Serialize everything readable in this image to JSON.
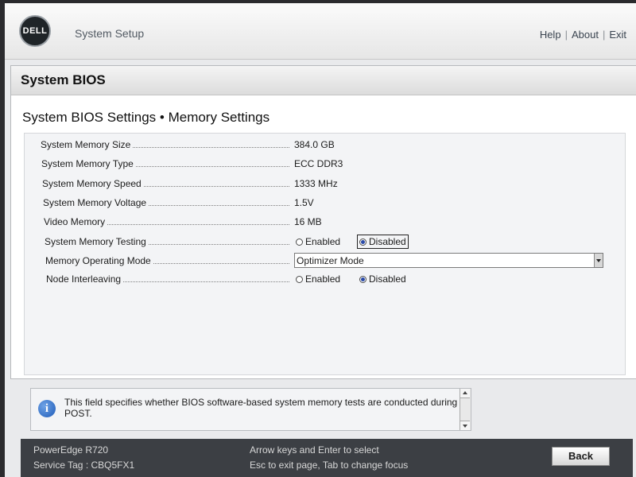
{
  "header": {
    "logo_text": "DELL",
    "app_title": "System Setup",
    "links": {
      "help": "Help",
      "about": "About",
      "exit": "Exit",
      "separator": "|"
    }
  },
  "panel": {
    "title": "System BIOS",
    "section_title": "System BIOS Settings • Memory Settings"
  },
  "settings": {
    "system_memory_size": {
      "label": "System Memory Size",
      "value": "384.0 GB"
    },
    "system_memory_type": {
      "label": "System Memory Type",
      "value": "ECC DDR3"
    },
    "system_memory_speed": {
      "label": "System Memory Speed",
      "value": "1333 MHz"
    },
    "system_memory_voltage": {
      "label": "System Memory Voltage",
      "value": "1.5V"
    },
    "video_memory": {
      "label": "Video Memory",
      "value": "16 MB"
    },
    "system_memory_testing": {
      "label": "System Memory Testing",
      "option_enabled": "Enabled",
      "option_disabled": "Disabled",
      "selected": "Disabled"
    },
    "memory_operating_mode": {
      "label": "Memory Operating Mode",
      "value": "Optimizer Mode"
    },
    "node_interleaving": {
      "label": "Node Interleaving",
      "option_enabled": "Enabled",
      "option_disabled": "Disabled",
      "selected": "Disabled"
    }
  },
  "help": {
    "icon": "info-icon",
    "text": "This field specifies whether BIOS software-based system memory tests are conducted during POST."
  },
  "footer": {
    "model": "PowerEdge R720",
    "service_tag": "Service Tag : CBQ5FX1",
    "hint_line1": "Arrow keys and Enter to select",
    "hint_line2": "Esc to exit page, Tab to change focus",
    "back_label": "Back"
  },
  "colors": {
    "radio_selected": "#2a4aa8",
    "footer_bg": "#3c3f44",
    "panel_bg": "#ffffff"
  }
}
